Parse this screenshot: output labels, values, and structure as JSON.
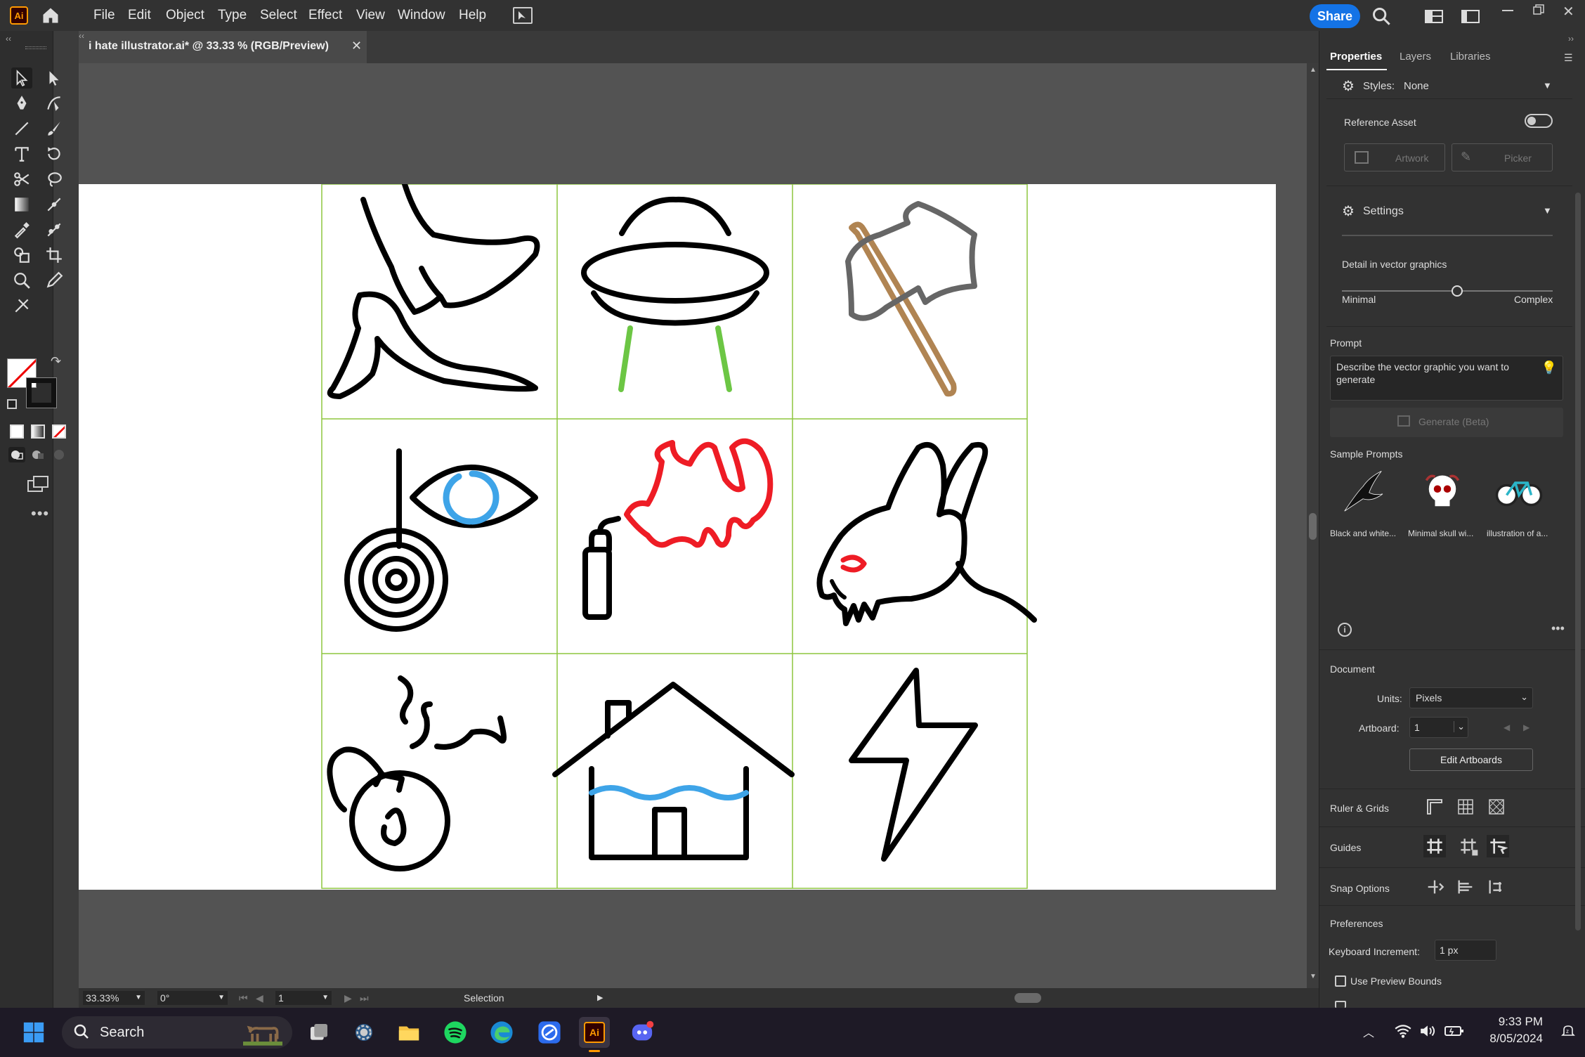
{
  "app": {
    "logo": "Ai",
    "menus": [
      "File",
      "Edit",
      "Object",
      "Type",
      "Select",
      "Effect",
      "View",
      "Window",
      "Help"
    ],
    "share_label": "Share"
  },
  "document": {
    "tab_title": "i hate illustrator.ai* @ 33.33 % (RGB/Preview)",
    "close": "✕"
  },
  "artwork": {
    "grid_color": "#8dc63f",
    "icons": [
      "boot-and-banana-icon",
      "ufo-icon",
      "axe-icon",
      "hypnosis-eye-icon",
      "fire-extinguisher-fire-icon",
      "demon-rabbit-icon",
      "bomb-smoke-icon",
      "flooded-house-icon",
      "lightning-bolt-icon"
    ],
    "colors": {
      "stroke": "#000000",
      "green": "#6cc644",
      "blue": "#3ea4e8",
      "red": "#ee1c25",
      "axe_handle": "#b08452",
      "axe_head": "#666666"
    }
  },
  "status": {
    "zoom": "33.33%",
    "rotation": "0°",
    "artboard": "1",
    "tool": "Selection"
  },
  "panel": {
    "tabs": [
      "Properties",
      "Layers",
      "Libraries"
    ],
    "styles_label": "Styles:",
    "styles_value": "None",
    "reference_asset": "Reference Asset",
    "artwork_btn": "Artwork",
    "picker_btn": "Picker",
    "settings_label": "Settings",
    "detail_label": "Detail in vector graphics",
    "detail_min": "Minimal",
    "detail_max": "Complex",
    "detail_level": 0.55,
    "prompt_label": "Prompt",
    "prompt_placeholder": "Describe the vector graphic you want to generate",
    "generate_btn": "Generate (Beta)",
    "sample_prompts_label": "Sample Prompts",
    "samples": [
      "Black and white...",
      "Minimal skull wi...",
      "illustration of a..."
    ],
    "document_label": "Document",
    "units_label": "Units:",
    "units_value": "Pixels",
    "artboard_label": "Artboard:",
    "artboard_value": "1",
    "edit_artboards": "Edit Artboards",
    "ruler_grids": "Ruler & Grids",
    "guides": "Guides",
    "snap_options": "Snap Options",
    "preferences": "Preferences",
    "keyboard_increment_label": "Keyboard Increment:",
    "keyboard_increment_value": "1 px",
    "use_preview_bounds": "Use Preview Bounds"
  },
  "taskbar": {
    "search_label": "Search",
    "time": "9:33 PM",
    "date": "8/05/2024"
  }
}
